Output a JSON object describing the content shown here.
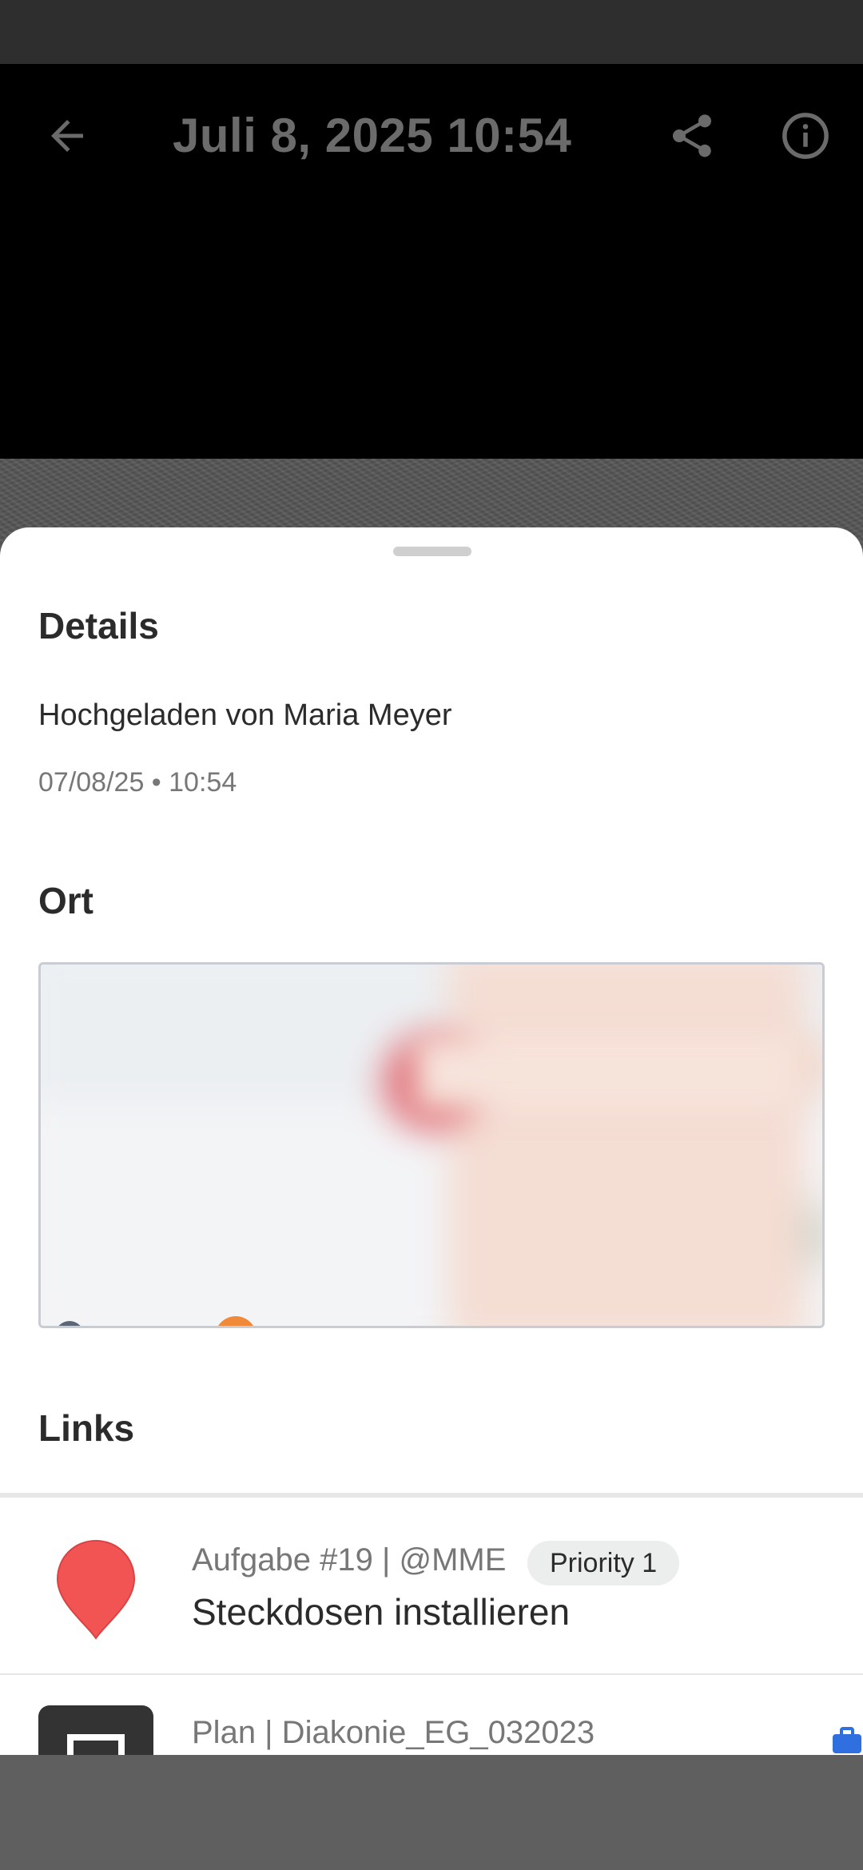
{
  "app_bar": {
    "title": "Juli 8, 2025 10:54",
    "back_icon": "arrow-back-icon",
    "share_icon": "share-icon",
    "info_icon": "info-icon"
  },
  "details": {
    "heading": "Details",
    "uploaded_by": "Hochgeladen von Maria Meyer",
    "date": "07/08/25 • 10:54"
  },
  "location": {
    "heading": "Ort"
  },
  "links": {
    "heading": "Links",
    "items": [
      {
        "subtitle": "Aufgabe #19 | @MME",
        "badge": "Priority 1",
        "title": "Steckdosen installieren",
        "icon": "map-pin-icon",
        "icon_color": "#f25353"
      },
      {
        "subtitle": "Plan | Diakonie_EG_032023",
        "icon": "plan-thumbnail-icon",
        "trailing_icon": "briefcase-icon",
        "trailing_color": "#2f6fe0"
      }
    ]
  },
  "colors": {
    "sheet_bg": "#ffffff",
    "scrim": "#5f5f5f",
    "appbar_bg": "#000000"
  }
}
